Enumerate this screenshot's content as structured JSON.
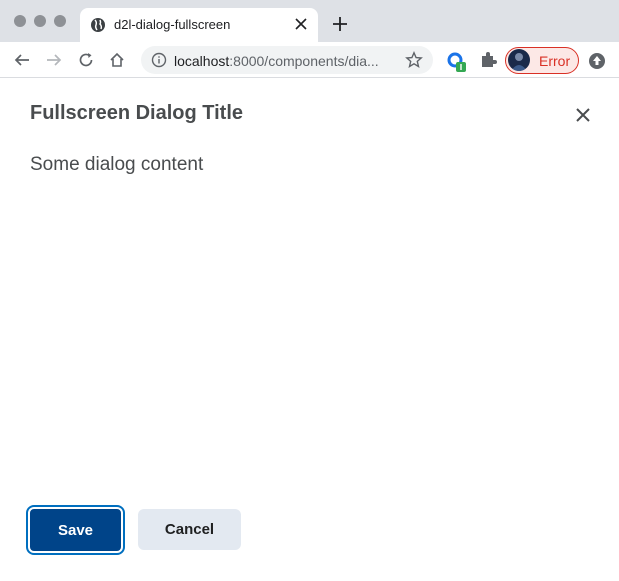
{
  "browser": {
    "tab": {
      "title": "d2l-dialog-fullscreen",
      "favicon": "globe-icon"
    },
    "new_tab_icon": "plus-icon",
    "toolbar": {
      "back_icon": "arrow-left-icon",
      "forward_icon": "arrow-right-icon",
      "reload_icon": "reload-icon",
      "home_icon": "home-icon",
      "url_host": "localhost",
      "url_rest": ":8000/components/dia...",
      "bookmark_icon": "star-icon",
      "profile_label": "Error"
    }
  },
  "dialog": {
    "title": "Fullscreen Dialog Title",
    "content": "Some dialog content",
    "save_label": "Save",
    "cancel_label": "Cancel"
  },
  "colors": {
    "primary_button": "#004489",
    "secondary_button": "#e3e9f1",
    "text": "#494c4e",
    "error": "#d93025"
  }
}
